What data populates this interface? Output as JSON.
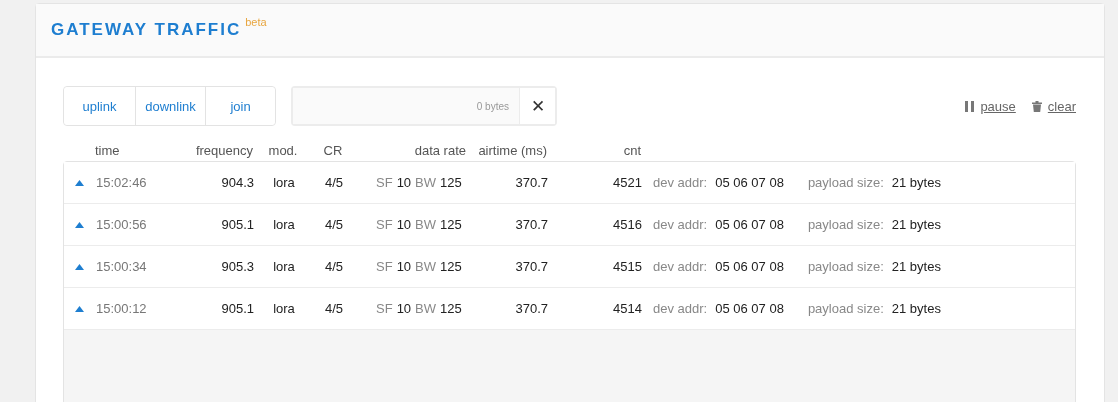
{
  "panel": {
    "title": "GATEWAY TRAFFIC",
    "badge": "beta"
  },
  "filters": [
    {
      "label": "uplink"
    },
    {
      "label": "downlink"
    },
    {
      "label": "join"
    }
  ],
  "search": {
    "hint": "0 bytes",
    "clear": "✕"
  },
  "actions": [
    {
      "kind": "pause",
      "label": "pause"
    },
    {
      "kind": "clear",
      "label": "clear"
    }
  ],
  "table": {
    "columns": [
      "time",
      "frequency",
      "mod.",
      "CR",
      "data rate",
      "airtime (ms)",
      "cnt"
    ],
    "rows": [
      {
        "time": "15:02:46",
        "frequency": "904.3",
        "mod": "lora",
        "cr": "4/5",
        "sf_label": "SF",
        "sf": "10",
        "bw_label": "BW",
        "bw": "125",
        "airtime": "370.7",
        "cnt": "4521",
        "addr_label": "dev addr:",
        "addr": "05 06 07 08",
        "size_label": "payload size:",
        "size": "21 bytes"
      },
      {
        "time": "15:00:56",
        "frequency": "905.1",
        "mod": "lora",
        "cr": "4/5",
        "sf_label": "SF",
        "sf": "10",
        "bw_label": "BW",
        "bw": "125",
        "airtime": "370.7",
        "cnt": "4516",
        "addr_label": "dev addr:",
        "addr": "05 06 07 08",
        "size_label": "payload size:",
        "size": "21 bytes"
      },
      {
        "time": "15:00:34",
        "frequency": "905.3",
        "mod": "lora",
        "cr": "4/5",
        "sf_label": "SF",
        "sf": "10",
        "bw_label": "BW",
        "bw": "125",
        "airtime": "370.7",
        "cnt": "4515",
        "addr_label": "dev addr:",
        "addr": "05 06 07 08",
        "size_label": "payload size:",
        "size": "21 bytes"
      },
      {
        "time": "15:00:12",
        "frequency": "905.1",
        "mod": "lora",
        "cr": "4/5",
        "sf_label": "SF",
        "sf": "10",
        "bw_label": "BW",
        "bw": "125",
        "airtime": "370.7",
        "cnt": "4514",
        "addr_label": "dev addr:",
        "addr": "05 06 07 08",
        "size_label": "payload size:",
        "size": "21 bytes"
      }
    ]
  }
}
